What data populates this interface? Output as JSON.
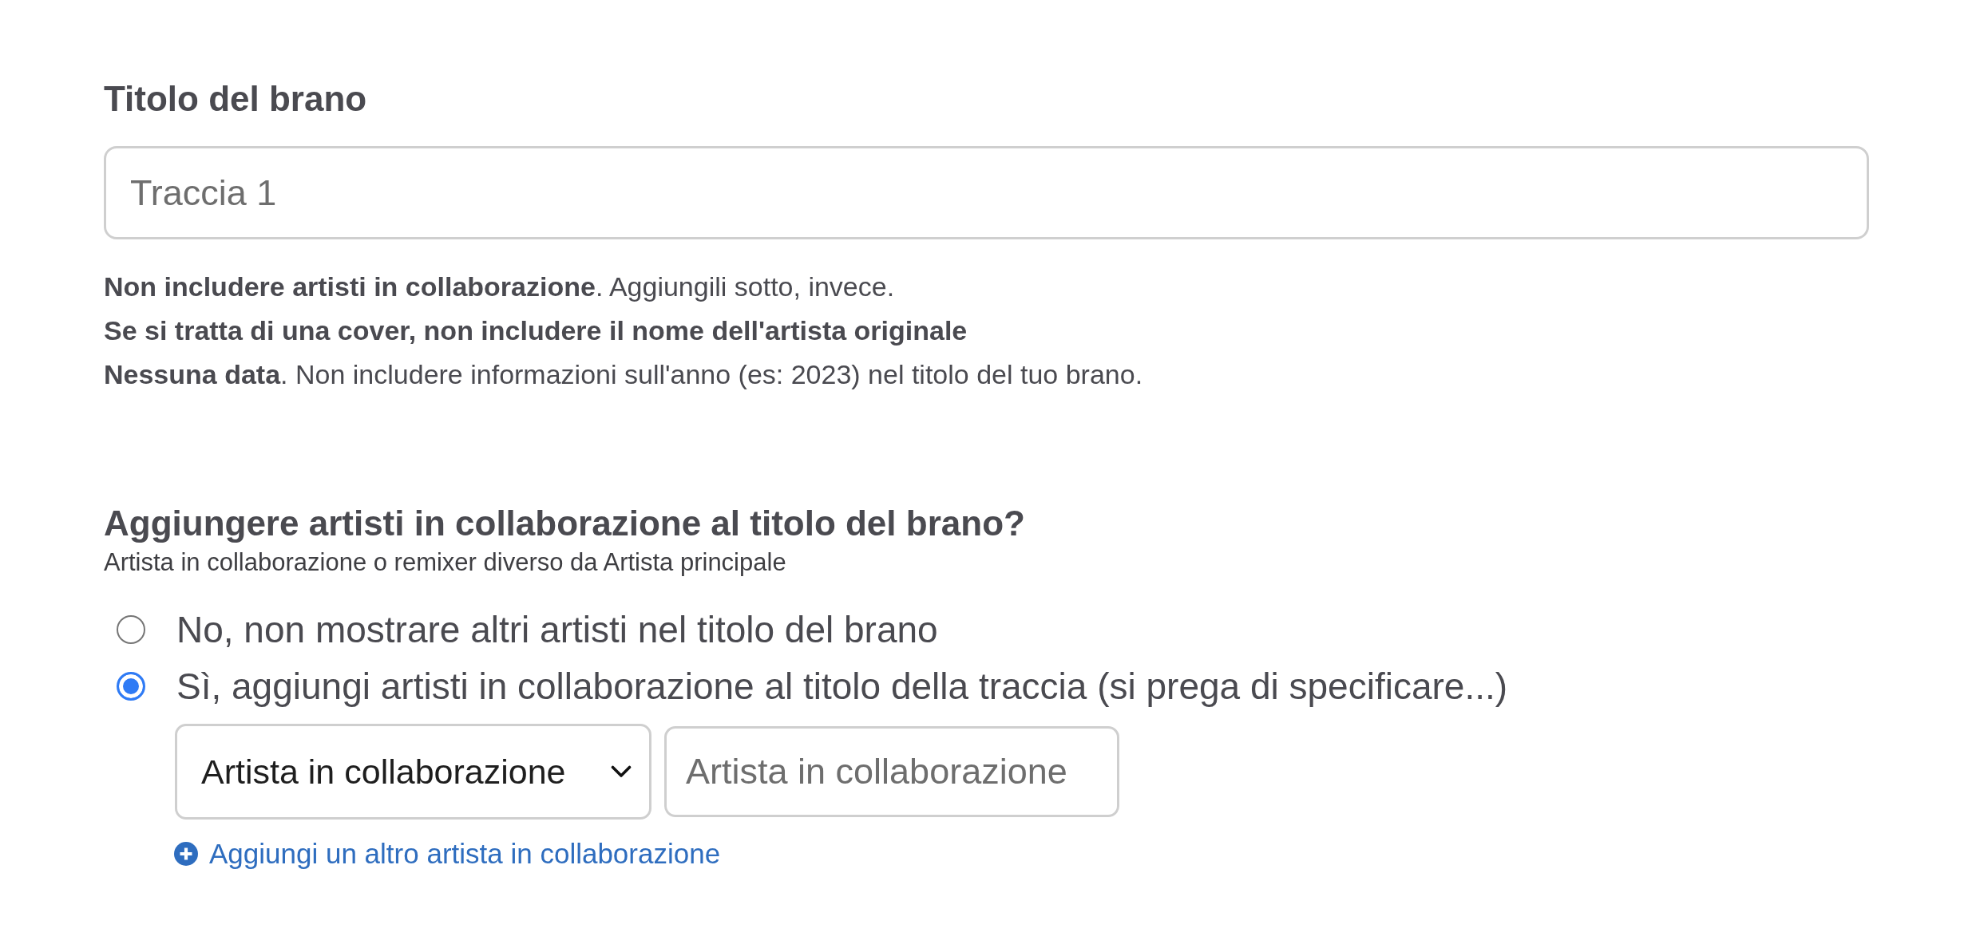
{
  "title_field": {
    "label": "Titolo del brano",
    "placeholder": "Traccia 1"
  },
  "hints": [
    {
      "text": "**Non includere artisti in collaborazione**. Aggiungili sotto, invece.",
      "bold": false
    },
    {
      "text": "Se si tratta di una cover, non includere il nome dell'artista originale",
      "bold": true
    },
    {
      "text": "**Nessuna data**. Non includere informazioni sull'anno (es: 2023) nel titolo del tuo brano.",
      "bold": false
    }
  ],
  "collaboration": {
    "heading": "Aggiungere artisti in collaborazione al titolo del brano?",
    "subheading": "Artista in collaborazione o remixer diverso da Artista principale",
    "options": [
      {
        "label": "No, non mostrare altri artisti nel titolo del brano",
        "selected": false
      },
      {
        "label": "Sì, aggiungi artisti in collaborazione al titolo della traccia (si prega di specificare...)",
        "selected": true
      }
    ],
    "artist_rows": [
      {
        "role": "Artista in collaborazione",
        "placeholder": "Artista in collaborazione"
      }
    ],
    "add_link": "Aggiungi un altro artista in collaborazione"
  }
}
